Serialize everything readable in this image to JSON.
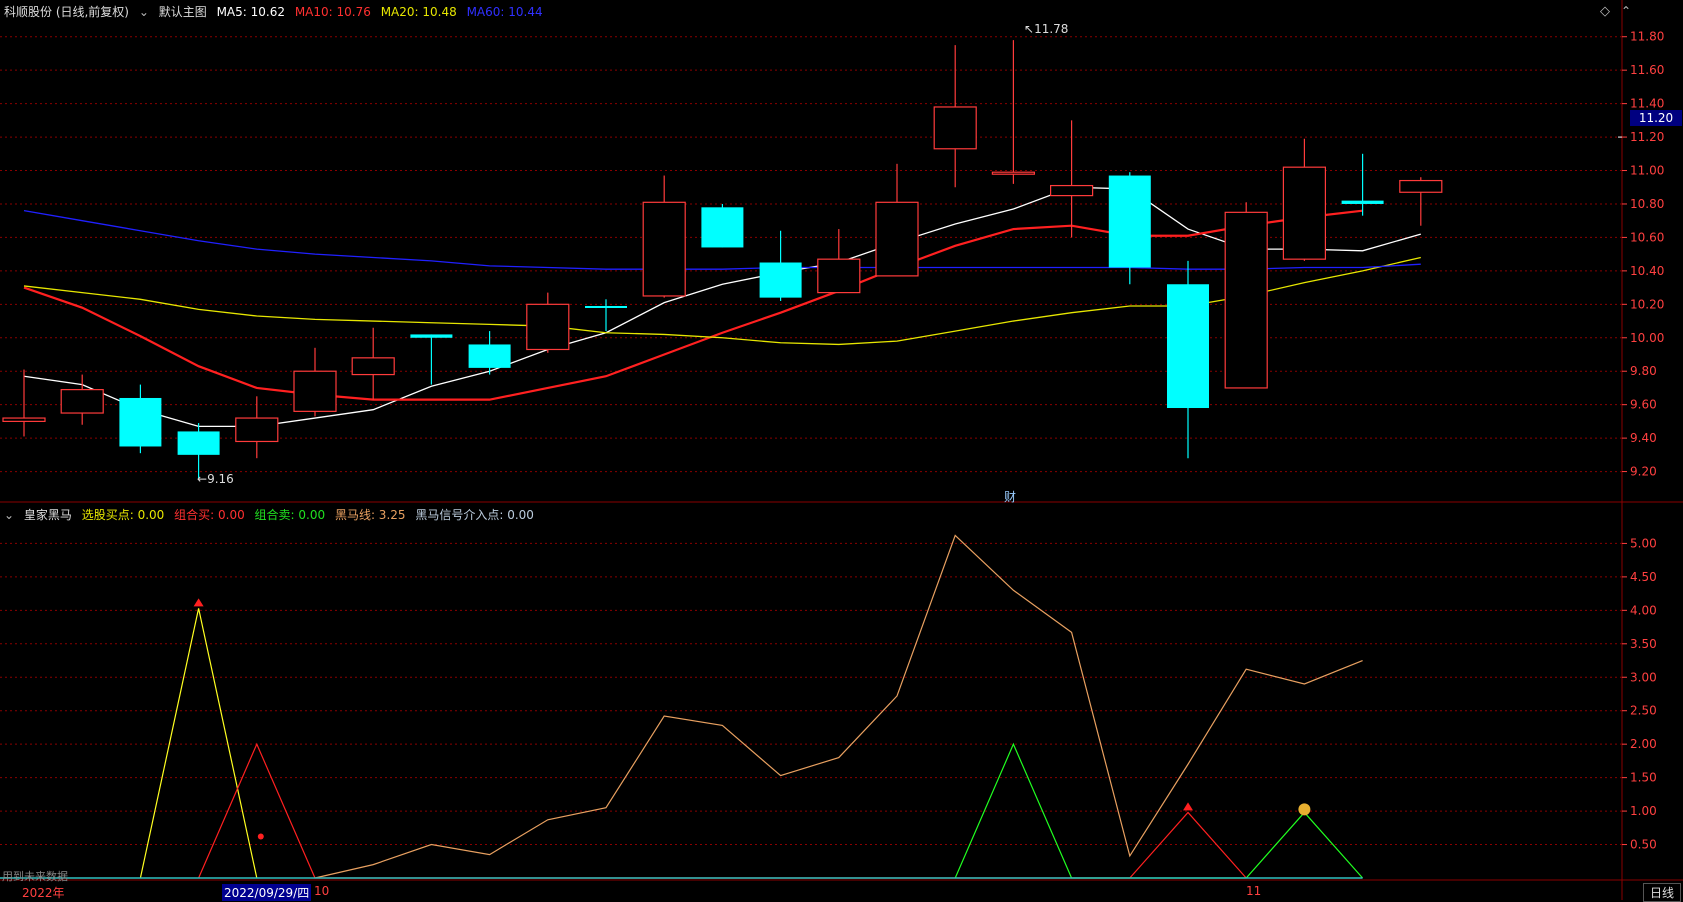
{
  "header": {
    "stock_title": "科顺股份 (日线,前复权)",
    "main_chart_label": "默认主图",
    "ma5_label": "MA5: 10.62",
    "ma10_label": "MA10: 10.76",
    "ma20_label": "MA20: 10.48",
    "ma60_label": "MA60: 10.44"
  },
  "sub_header": {
    "indicator_name": "皇家黑马",
    "buy_point_label": "选股买点: 0.00",
    "combo_buy_label": "组合买: 0.00",
    "combo_sell_label": "组合卖: 0.00",
    "black_horse_label": "黑马线: 3.25",
    "signal_label": "黑马信号介入点: 0.00"
  },
  "footer": {
    "year_label": "2022年",
    "date_cursor": "2022/09/29/四",
    "month_10": "10",
    "month_11": "11",
    "period_button": "日线",
    "future_data_note": "用到未来数据"
  },
  "annotations": {
    "high_label": "11.78",
    "low_label": "9.16",
    "finance_marker": "财",
    "current_price": "11.20"
  },
  "colors": {
    "background": "#000000",
    "up_candle": "#ff3b3b",
    "down_candle": "#00ffff",
    "ma5": "#ffffff",
    "ma10": "#ff2020",
    "ma20": "#e6e600",
    "ma60": "#2020ff",
    "black_horse_line": "#e8a060",
    "grid": "#8a0000",
    "axis_text": "#ff4040"
  },
  "chart_data": [
    {
      "type": "candlestick",
      "title": "科顺股份 (日线,前复权)",
      "y_ticks": [
        9.2,
        9.4,
        9.6,
        9.8,
        10.0,
        10.2,
        10.4,
        10.6,
        10.8,
        11.0,
        11.2,
        11.4,
        11.6,
        11.8
      ],
      "ylim": [
        9.03,
        11.9
      ],
      "grid": true,
      "candles": [
        {
          "o": 9.5,
          "h": 9.81,
          "l": 9.41,
          "c": 9.52
        },
        {
          "o": 9.55,
          "h": 9.78,
          "l": 9.48,
          "c": 9.69
        },
        {
          "o": 9.64,
          "h": 9.72,
          "l": 9.31,
          "c": 9.35
        },
        {
          "o": 9.44,
          "h": 9.49,
          "l": 9.16,
          "c": 9.3
        },
        {
          "o": 9.38,
          "h": 9.65,
          "l": 9.28,
          "c": 9.52
        },
        {
          "o": 9.56,
          "h": 9.94,
          "l": 9.53,
          "c": 9.8
        },
        {
          "o": 9.78,
          "h": 10.06,
          "l": 9.63,
          "c": 9.88
        },
        {
          "o": 10.02,
          "h": 10.02,
          "l": 9.72,
          "c": 10.0
        },
        {
          "o": 9.96,
          "h": 10.04,
          "l": 9.78,
          "c": 9.82
        },
        {
          "o": 9.93,
          "h": 10.27,
          "l": 9.91,
          "c": 10.2
        },
        {
          "o": 10.19,
          "h": 10.23,
          "l": 10.04,
          "c": 10.18
        },
        {
          "o": 10.25,
          "h": 10.97,
          "l": 10.24,
          "c": 10.81
        },
        {
          "o": 10.78,
          "h": 10.8,
          "l": 10.54,
          "c": 10.54
        },
        {
          "o": 10.45,
          "h": 10.64,
          "l": 10.22,
          "c": 10.24
        },
        {
          "o": 10.27,
          "h": 10.65,
          "l": 10.27,
          "c": 10.47
        },
        {
          "o": 10.37,
          "h": 11.04,
          "l": 10.37,
          "c": 10.81
        },
        {
          "o": 11.13,
          "h": 11.75,
          "l": 10.9,
          "c": 11.38
        },
        {
          "o": 10.99,
          "h": 11.78,
          "l": 10.92,
          "c": 10.99
        },
        {
          "o": 10.85,
          "h": 11.3,
          "l": 10.6,
          "c": 10.91
        },
        {
          "o": 10.97,
          "h": 10.99,
          "l": 10.32,
          "c": 10.42
        },
        {
          "o": 10.32,
          "h": 10.46,
          "l": 9.28,
          "c": 9.58
        },
        {
          "o": 9.7,
          "h": 10.81,
          "l": 9.7,
          "c": 10.75
        },
        {
          "o": 10.47,
          "h": 11.19,
          "l": 10.46,
          "c": 11.02
        },
        {
          "o": 10.82,
          "h": 11.1,
          "l": 10.73,
          "c": 10.8
        },
        {
          "o": 10.87,
          "h": 10.96,
          "l": 10.67,
          "c": 10.94
        }
      ],
      "series": [
        {
          "name": "MA5",
          "values": [
            9.77,
            9.72,
            9.57,
            9.47,
            9.47,
            9.52,
            9.57,
            9.71,
            9.8,
            9.93,
            10.03,
            10.21,
            10.32,
            10.39,
            10.45,
            10.57,
            10.68,
            10.77,
            10.9,
            10.89,
            10.65,
            10.53,
            10.53,
            10.52,
            10.62
          ]
        },
        {
          "name": "MA10",
          "values": [
            10.3,
            10.18,
            10.01,
            9.83,
            9.7,
            9.66,
            9.63,
            9.63,
            9.63,
            9.7,
            9.77,
            9.9,
            10.03,
            10.15,
            10.28,
            10.42,
            10.55,
            10.65,
            10.67,
            10.61,
            10.61,
            10.67,
            10.72,
            10.76
          ]
        },
        {
          "name": "MA20",
          "values": [
            10.31,
            10.27,
            10.23,
            10.17,
            10.13,
            10.11,
            10.1,
            10.09,
            10.08,
            10.07,
            10.03,
            10.02,
            10.0,
            9.97,
            9.96,
            9.98,
            10.04,
            10.1,
            10.15,
            10.19,
            10.19,
            10.25,
            10.33,
            10.4,
            10.48
          ]
        },
        {
          "name": "MA60",
          "values": [
            10.76,
            10.7,
            10.64,
            10.58,
            10.53,
            10.5,
            10.48,
            10.46,
            10.43,
            10.42,
            10.41,
            10.41,
            10.41,
            10.42,
            10.42,
            10.42,
            10.42,
            10.42,
            10.42,
            10.42,
            10.41,
            10.41,
            10.42,
            10.42,
            10.44
          ]
        }
      ],
      "current_price": 11.2
    },
    {
      "type": "line",
      "title": "皇家黑马",
      "y_ticks": [
        0.5,
        1.0,
        1.5,
        2.0,
        2.5,
        3.0,
        3.5,
        4.0,
        4.5,
        5.0
      ],
      "ylim": [
        0,
        5.35
      ],
      "grid": true,
      "series": [
        {
          "name": "黑马线",
          "values": [
            null,
            null,
            null,
            null,
            null,
            0,
            0.2,
            0.5,
            0.35,
            0.87,
            1.05,
            2.42,
            2.28,
            1.53,
            1.8,
            2.72,
            5.12,
            4.3,
            3.67,
            0.33,
            1.7,
            3.12,
            2.9,
            3.25
          ]
        },
        {
          "name": "选股买点",
          "values": [
            null,
            null,
            0,
            4.03,
            0,
            null,
            null,
            null,
            null,
            null,
            null,
            null,
            null,
            null,
            null,
            null,
            null,
            null,
            null,
            null,
            null,
            null,
            null,
            null
          ]
        },
        {
          "name": "组合买",
          "values": [
            null,
            null,
            null,
            0,
            2.0,
            0,
            null,
            null,
            null,
            null,
            null,
            null,
            null,
            null,
            null,
            null,
            null,
            null,
            null,
            0,
            0.98,
            0,
            null,
            null
          ]
        },
        {
          "name": "组合卖",
          "values": [
            null,
            null,
            null,
            null,
            null,
            null,
            null,
            null,
            null,
            null,
            null,
            null,
            null,
            null,
            null,
            null,
            0,
            2.0,
            0,
            null,
            null,
            0,
            0.98,
            0
          ]
        }
      ]
    }
  ]
}
